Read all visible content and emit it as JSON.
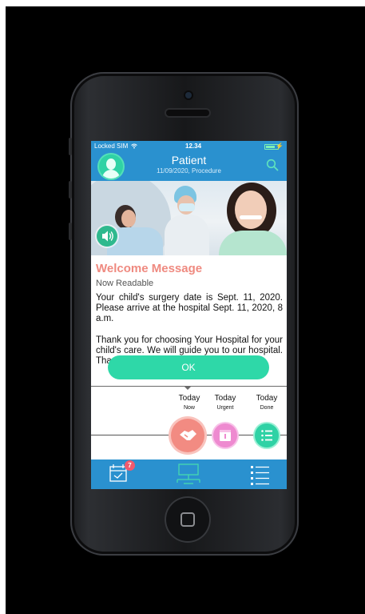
{
  "status_bar": {
    "carrier": "Locked SIM",
    "wifi_icon": "wifi-icon",
    "time": "12.34",
    "battery_icon": "battery-charging-icon",
    "charging_glyph": "⚡"
  },
  "header": {
    "title": "Patient",
    "subtitle": "11/09/2020, Procedure",
    "avatar_icon": "patient-avatar-icon",
    "search_icon": "search-icon"
  },
  "hero": {
    "image": "dental-clinic-photo",
    "audio_icon": "speaker-icon"
  },
  "message": {
    "title": "Welcome Message",
    "status": "Now Readable",
    "paragraph1": "Your child's surgery date is Sept. 11, 2020. Please arrive at the hospital Sept. 11, 2020, 8 a.m.",
    "paragraph2": "Thank you for choosing Your Hospital for your child's care. We will guide you to our hospital. Thank you to guide"
  },
  "ok_button": {
    "label": "OK"
  },
  "timeline": {
    "columns": [
      {
        "day": "Today",
        "status": "Now"
      },
      {
        "day": "Today",
        "status": "Urgent"
      },
      {
        "day": "Today",
        "status": "Done"
      }
    ],
    "icons": [
      "handshake-icon",
      "notice-icon",
      "checklist-icon"
    ]
  },
  "tabbar": {
    "calendar_badge": "7",
    "tabs": [
      "calendar-icon",
      "network-icon",
      "list-icon"
    ]
  },
  "colors": {
    "brand_blue": "#2a91cf",
    "accent_green": "#2ed8a8",
    "welcome_coral": "#ef8a80",
    "urgent_pink": "#ee8ad0",
    "badge_red": "#ef5a6e"
  }
}
